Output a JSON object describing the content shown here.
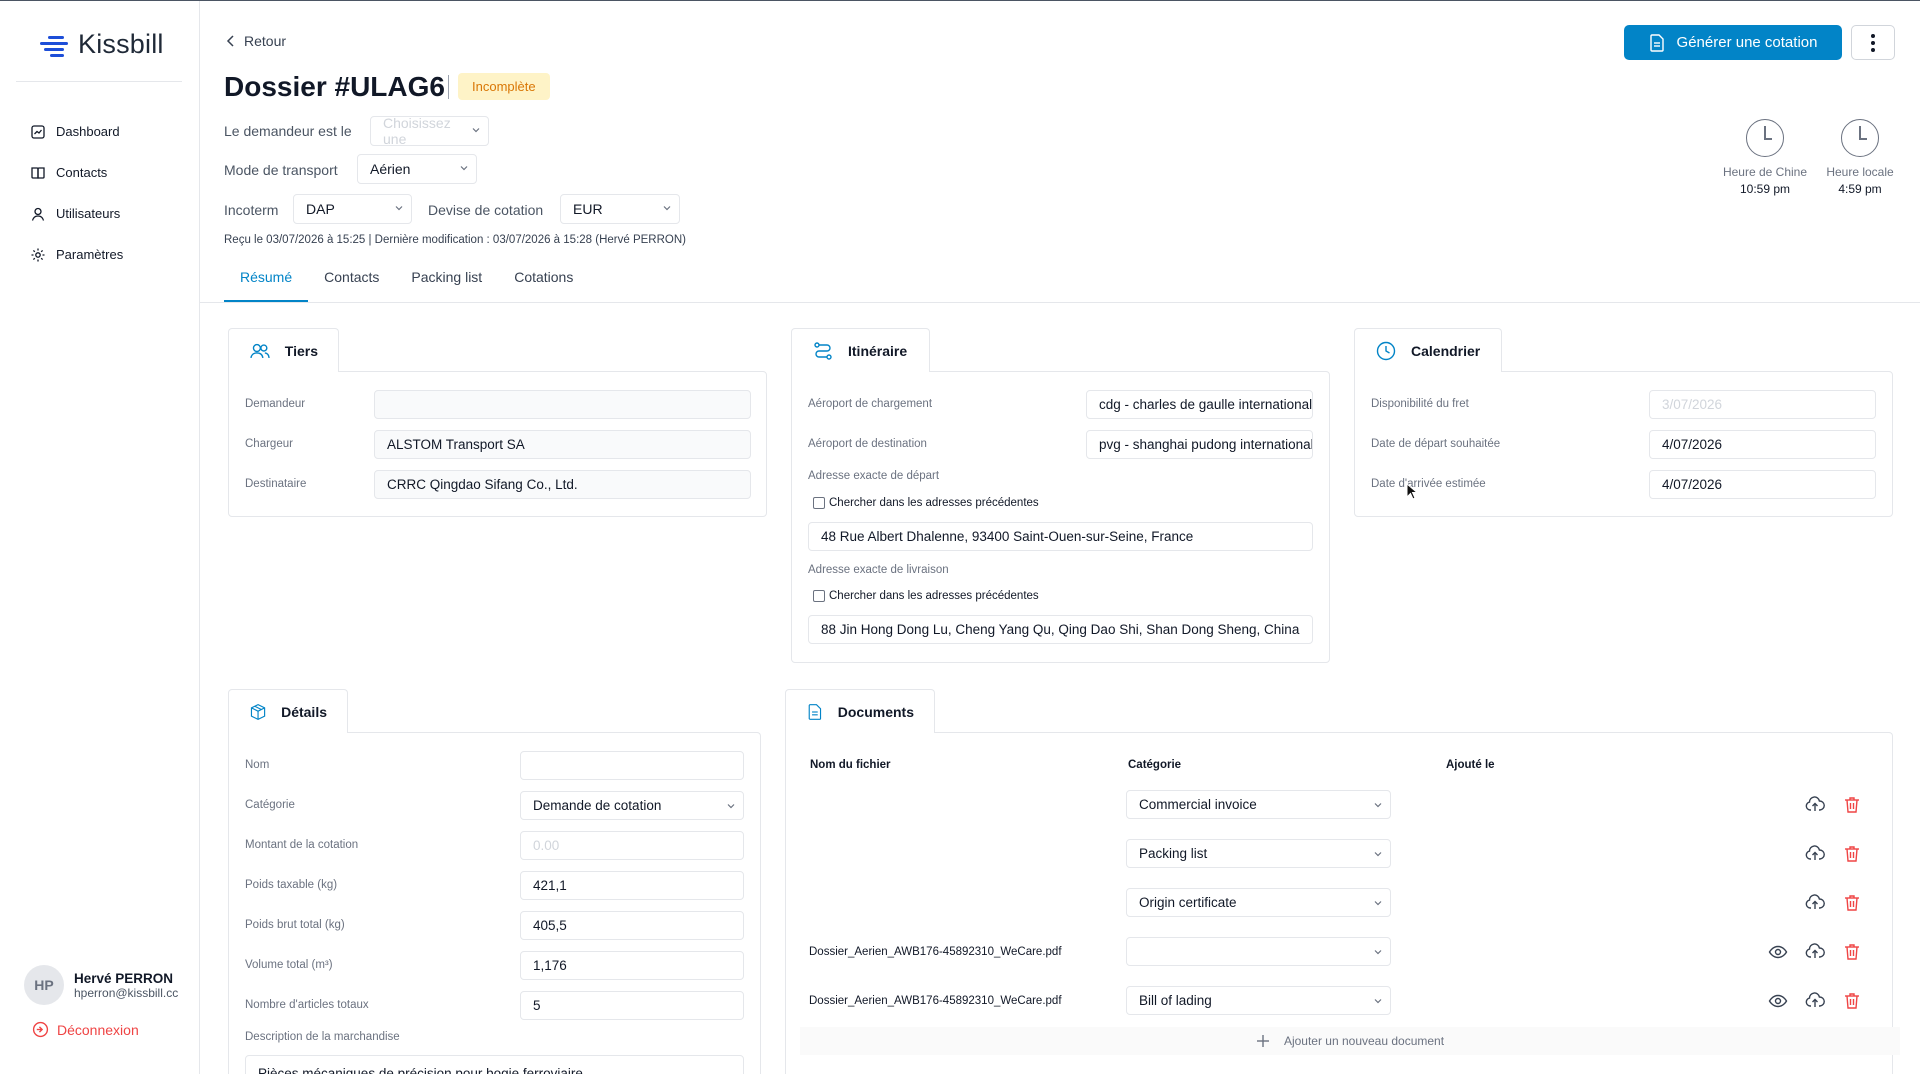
{
  "app": {
    "name": "Kissbill"
  },
  "nav": {
    "items": [
      {
        "label": "Dashboard",
        "icon": "dashboard-icon"
      },
      {
        "label": "Contacts",
        "icon": "book-icon"
      },
      {
        "label": "Utilisateurs",
        "icon": "user-icon"
      },
      {
        "label": "Paramètres",
        "icon": "gear-icon"
      }
    ]
  },
  "user": {
    "initials": "HP",
    "name": "Hervé PERRON",
    "email": "hperron@kissbill.cc"
  },
  "logout_label": "Déconnexion",
  "header": {
    "back_label": "Retour",
    "title": "Dossier #ULAG6",
    "status_badge": "Incomplète",
    "generate_button": "Générer une cotation",
    "requester_label": "Le demandeur est le",
    "requester_placeholder": "Choisissez une",
    "transport_label": "Mode de transport",
    "transport_value": "Aérien",
    "incoterm_label": "Incoterm",
    "incoterm_value": "DAP",
    "currency_label": "Devise de cotation",
    "currency_value": "EUR",
    "meta": "Reçu le 03/07/2026 à 15:25  |  Dernière modification : 03/07/2026 à 15:28 (Hervé PERRON)"
  },
  "clocks": [
    {
      "label": "Heure de Chine",
      "time": "10:59 pm"
    },
    {
      "label": "Heure locale",
      "time": "4:59 pm"
    }
  ],
  "tabs": [
    "Résumé",
    "Contacts",
    "Packing list",
    "Cotations"
  ],
  "tiers": {
    "title": "Tiers",
    "demandeur_label": "Demandeur",
    "demandeur_value": "",
    "chargeur_label": "Chargeur",
    "chargeur_value": "ALSTOM Transport SA",
    "destinataire_label": "Destinataire",
    "destinataire_value": "CRRC Qingdao Sifang Co., Ltd."
  },
  "itineraire": {
    "title": "Itinéraire",
    "load_label": "Aéroport de chargement",
    "load_value": "cdg - charles de gaulle international",
    "dest_label": "Aéroport de destination",
    "dest_value": "pvg - shanghai pudong international",
    "dep_addr_label": "Adresse exacte de départ",
    "dep_search_label": "Chercher dans les adresses précédentes",
    "dep_addr_value": "48 Rue Albert Dhalenne, 93400 Saint-Ouen-sur-Seine, France",
    "del_addr_label": "Adresse exacte de livraison",
    "del_search_label": "Chercher dans les adresses précédentes",
    "del_addr_value": "88 Jin Hong Dong Lu, Cheng Yang Qu, Qing Dao Shi, Shan Dong Sheng, China"
  },
  "calendrier": {
    "title": "Calendrier",
    "dispo_label": "Disponibilité du fret",
    "dispo_value": "3/07/2026",
    "depart_label": "Date de départ souhaitée",
    "depart_value": "4/07/2026",
    "arrivee_label": "Date d'arrivée estimée",
    "arrivee_value": "4/07/2026"
  },
  "details": {
    "title": "Détails",
    "nom_label": "Nom",
    "nom_value": "",
    "categorie_label": "Catégorie",
    "categorie_value": "Demande de cotation",
    "montant_label": "Montant de la cotation",
    "montant_placeholder": "0.00",
    "poids_tax_label": "Poids taxable (kg)",
    "poids_tax_value": "421,1",
    "poids_brut_label": "Poids brut total (kg)",
    "poids_brut_value": "405,5",
    "volume_label": "Volume total (m³)",
    "volume_value": "1,176",
    "articles_label": "Nombre d'articles totaux",
    "articles_value": "5",
    "desc_label": "Description de la marchandise",
    "desc_value": "Pièces mécaniques de précision pour bogie ferroviaire"
  },
  "documents": {
    "title": "Documents",
    "col_file": "Nom du fichier",
    "col_category": "Catégorie",
    "col_added": "Ajouté le",
    "rows": [
      {
        "file": "",
        "category": "Commercial invoice"
      },
      {
        "file": "",
        "category": "Packing list"
      },
      {
        "file": "",
        "category": "Origin certificate"
      },
      {
        "file": "Dossier_Aerien_AWB176-45892310_WeCare.pdf",
        "category": ""
      },
      {
        "file": "Dossier_Aerien_AWB176-45892310_WeCare.pdf",
        "category": "Bill of lading"
      }
    ],
    "add_label": "Ajouter un nouveau document"
  },
  "colors": {
    "accent": "#0284c7",
    "danger": "#ef4444",
    "warning_bg": "#fef3c7",
    "warning_text": "#d97706"
  }
}
